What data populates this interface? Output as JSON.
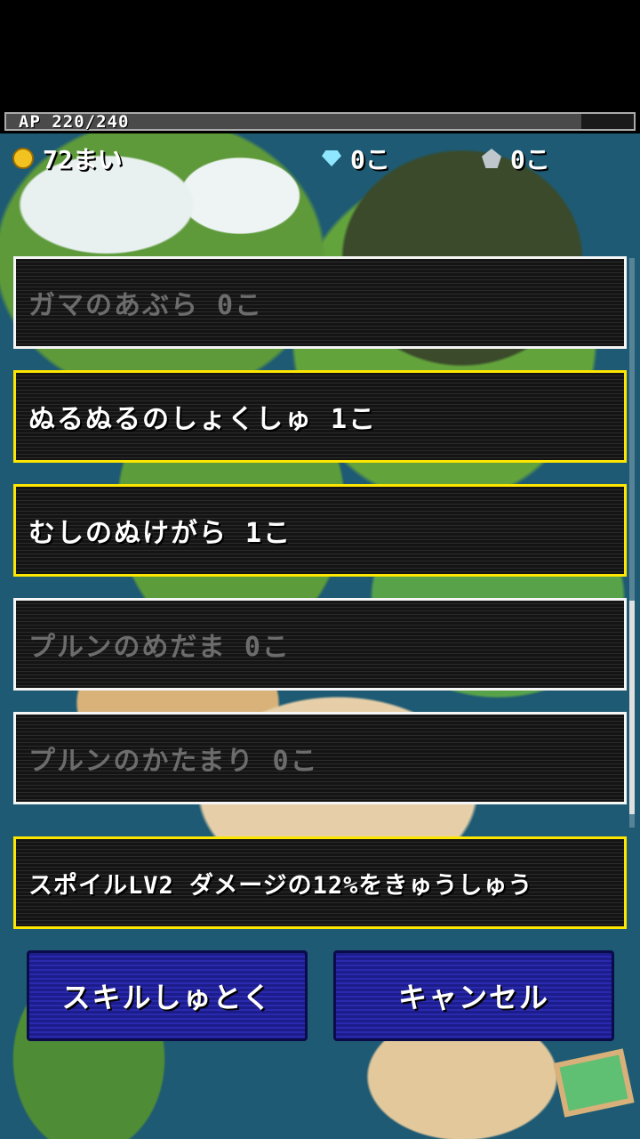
{
  "status": {
    "ap_text": "AP 220/240",
    "ap_current": 220,
    "ap_max": 240,
    "gold_text": "72まい",
    "diamond_text": "0こ",
    "ore_text": "0こ"
  },
  "items": [
    {
      "label": "ガマのあぶら 0こ",
      "available": false
    },
    {
      "label": "ぬるぬるのしょくしゅ 1こ",
      "available": true
    },
    {
      "label": "むしのぬけがら 1こ",
      "available": true
    },
    {
      "label": "プルンのめだま 0こ",
      "available": false
    },
    {
      "label": "プルンのかたまり 0こ",
      "available": false
    }
  ],
  "skill": {
    "label": "スポイルLV2 ダメージの12%をきゅうしゅう"
  },
  "buttons": {
    "learn": "スキルしゅとく",
    "cancel": "キャンセル"
  },
  "icons": {
    "gold": "coin-icon",
    "diamond": "diamond-icon",
    "ore": "ore-icon",
    "menu": "notebook-icon"
  },
  "colors": {
    "highlight_border": "#ffe600",
    "disabled_border": "#f5f5f5",
    "button_blue": "#2a2ab0"
  }
}
